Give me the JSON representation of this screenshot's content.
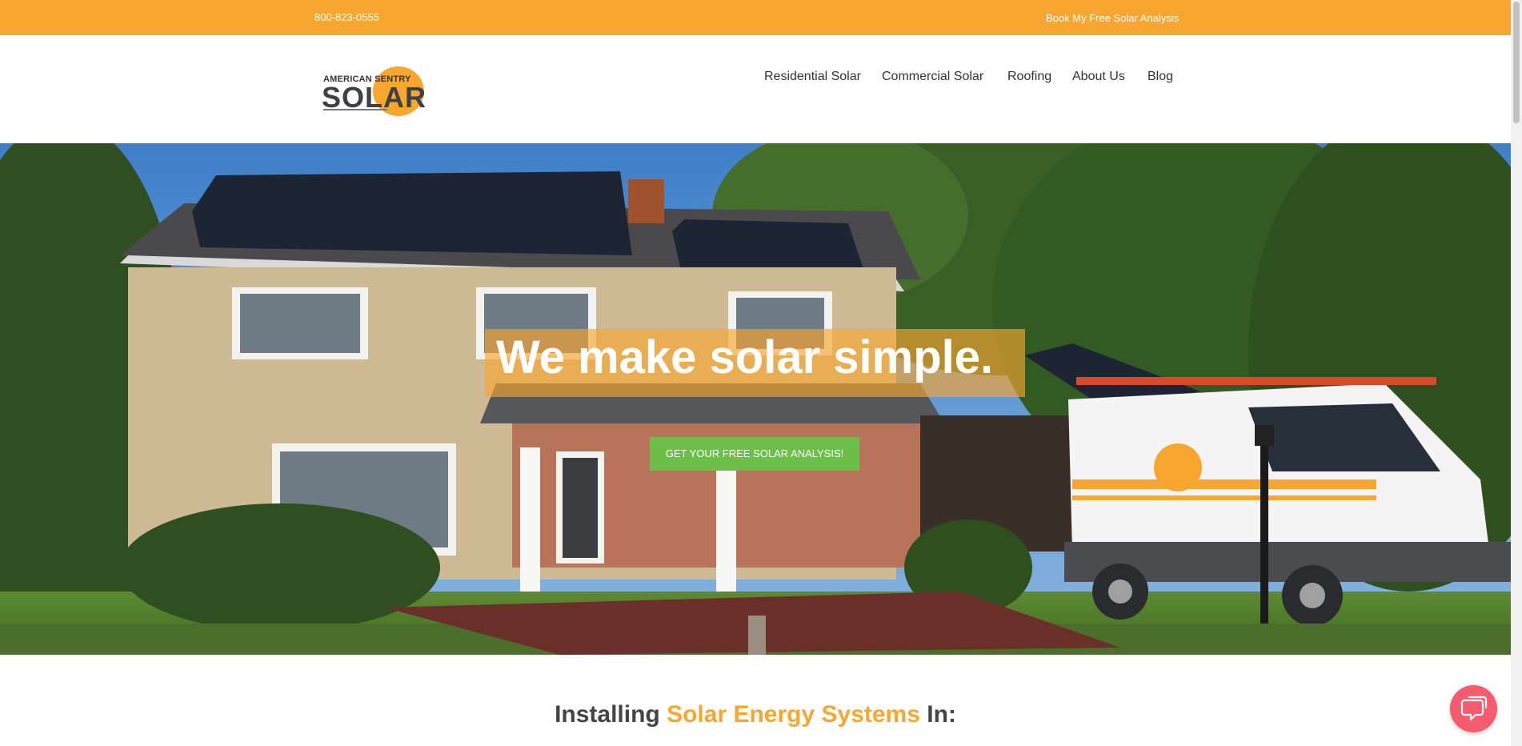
{
  "topbar": {
    "phone": "800-823-0555",
    "book_label": "Book My Free Solar Analysis"
  },
  "logo": {
    "top_text": "AMERICAN SENTRY",
    "brand": "SOLAR"
  },
  "nav": {
    "items": [
      {
        "label": "Residential Solar"
      },
      {
        "label": "Commercial Solar"
      },
      {
        "label": "Roofing"
      },
      {
        "label": "About Us"
      },
      {
        "label": "Blog"
      }
    ]
  },
  "hero": {
    "headline": "We make solar simple.",
    "cta_label": "GET YOUR FREE SOLAR ANALYSIS!"
  },
  "section": {
    "title_prefix": "Installing ",
    "title_accent": "Solar Energy Systems",
    "title_suffix": " In:"
  },
  "colors": {
    "accent": "#f7a630",
    "cta": "#6cbf49",
    "chat": "#f65c6d"
  },
  "icons": {
    "chat": "chat-bubble-icon"
  }
}
